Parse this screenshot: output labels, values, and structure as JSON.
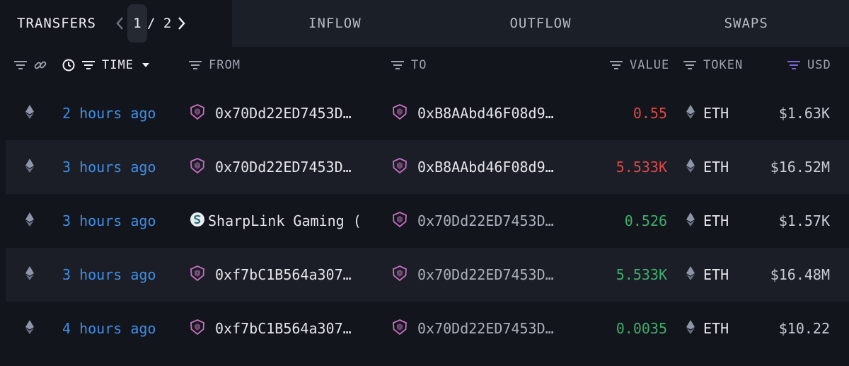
{
  "tabs": {
    "transfers": "TRANSFERS",
    "page_current": "1",
    "page_rest": "/ 2",
    "inflow": "INFLOW",
    "outflow": "OUTFLOW",
    "swaps": "SWAPS"
  },
  "columns": {
    "time": "TIME",
    "from": "FROM",
    "to": "TO",
    "value": "VALUE",
    "token": "TOKEN",
    "usd": "USD"
  },
  "colors": {
    "negative": "#e04848",
    "positive": "#3fae6a",
    "time_link": "#3f8ee6",
    "entity_icon": "#c86fc0"
  },
  "rows": [
    {
      "time": "2 hours ago",
      "from": "0x70Dd22ED7453D…",
      "from_icon": "entity-icon",
      "to": "0xB8AAbd46F08d9…",
      "to_icon": "entity-icon",
      "value": "0.55",
      "value_sign": "negative",
      "token": "ETH",
      "usd": "$1.63K"
    },
    {
      "time": "3 hours ago",
      "from": "0x70Dd22ED7453D…",
      "from_icon": "entity-icon",
      "to": "0xB8AAbd46F08d9…",
      "to_icon": "entity-icon",
      "value": "5.533K",
      "value_sign": "negative",
      "token": "ETH",
      "usd": "$16.52M"
    },
    {
      "time": "3 hours ago",
      "from": "SharpLink Gaming (",
      "from_icon": "sharplink-logo-icon",
      "to": "0x70Dd22ED7453D…",
      "to_icon": "entity-icon",
      "value": "0.526",
      "value_sign": "positive",
      "token": "ETH",
      "usd": "$1.57K"
    },
    {
      "time": "3 hours ago",
      "from": "0xf7bC1B564a307…",
      "from_icon": "entity-icon",
      "to": "0x70Dd22ED7453D…",
      "to_icon": "entity-icon",
      "value": "5.533K",
      "value_sign": "positive",
      "token": "ETH",
      "usd": "$16.48M"
    },
    {
      "time": "4 hours ago",
      "from": "0xf7bC1B564a307…",
      "from_icon": "entity-icon",
      "to": "0x70Dd22ED7453D…",
      "to_icon": "entity-icon",
      "value": "0.0035",
      "value_sign": "positive",
      "token": "ETH",
      "usd": "$10.22"
    }
  ]
}
